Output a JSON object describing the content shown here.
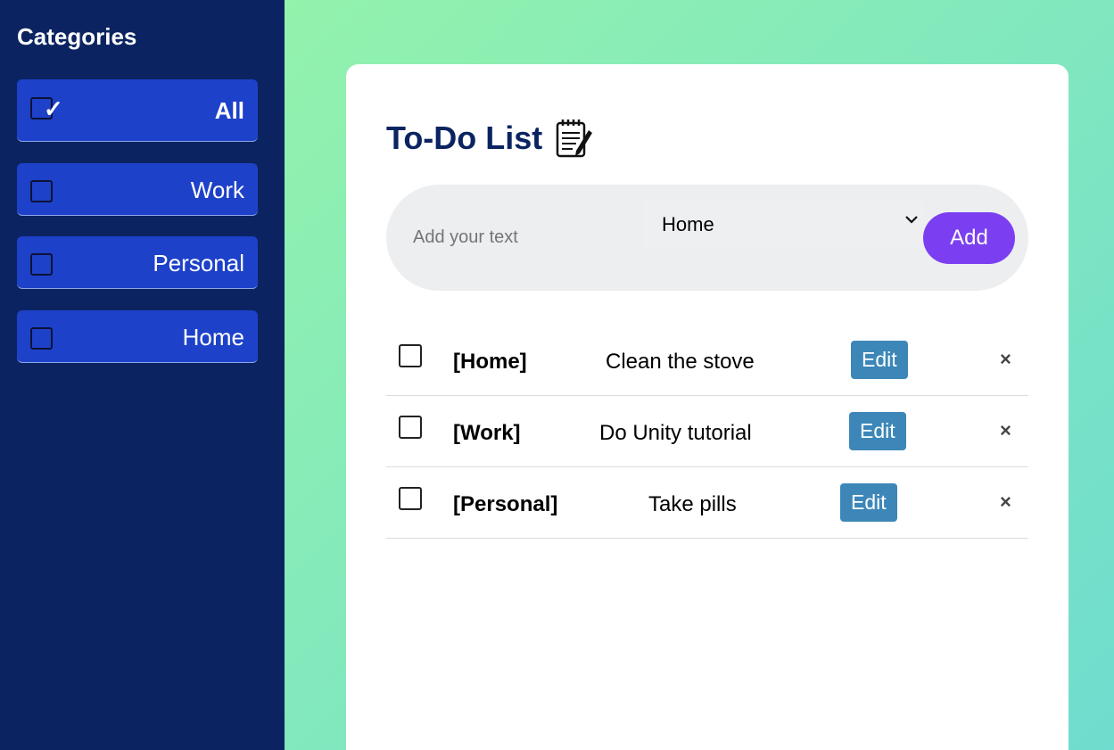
{
  "sidebar": {
    "title": "Categories",
    "items": [
      {
        "label": "All",
        "checked": true
      },
      {
        "label": "Work",
        "checked": false
      },
      {
        "label": "Personal",
        "checked": false
      },
      {
        "label": "Home",
        "checked": false
      }
    ]
  },
  "main": {
    "title": "To-Do List",
    "title_icon": "notepad-pencil-icon",
    "input": {
      "placeholder": "Add your text",
      "value": ""
    },
    "category_select": {
      "selected": "Home"
    },
    "add_label": "Add",
    "todos": [
      {
        "category": "[Home]",
        "text": "Clean the stove",
        "done": false
      },
      {
        "category": "[Work]",
        "text": "Do Unity tutorial",
        "done": false
      },
      {
        "category": "[Personal]",
        "text": "Take pills",
        "done": false
      }
    ],
    "edit_label": "Edit",
    "delete_symbol": "×"
  },
  "colors": {
    "sidebar_bg": "#0b2461",
    "category_button": "#1d41c9",
    "add_button": "#7b3ff1",
    "edit_button": "#3c87b8",
    "title": "#0b2461"
  }
}
